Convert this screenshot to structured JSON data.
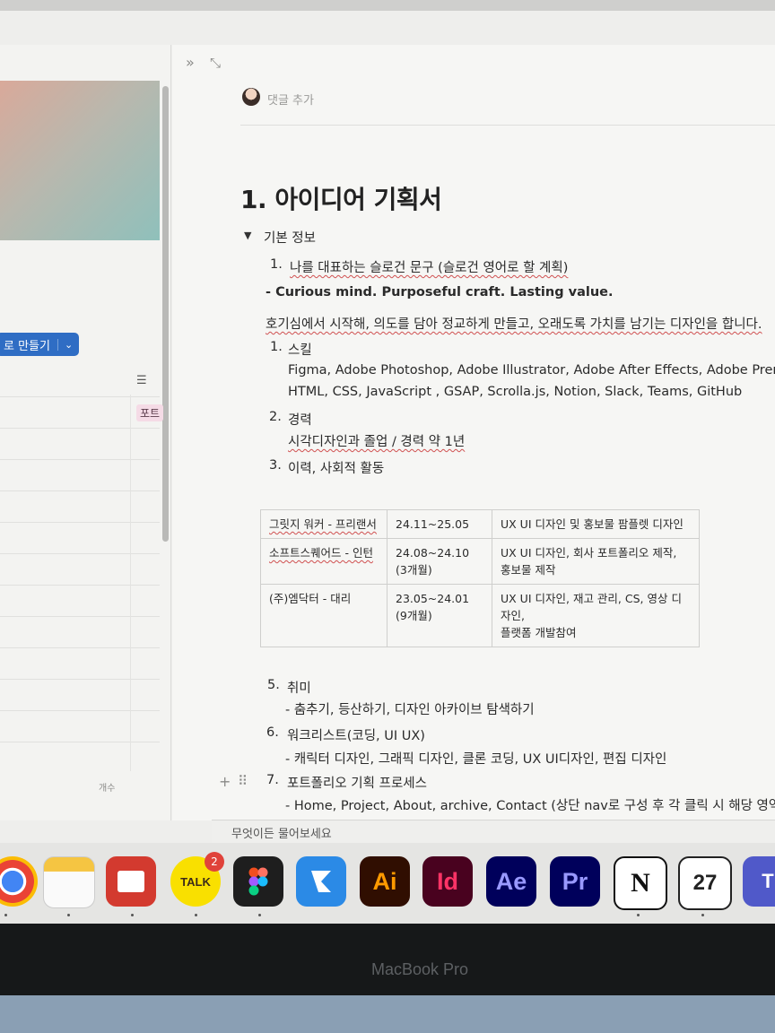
{
  "left_pane": {
    "create_button_label": "로 만들기",
    "create_button_chevron": "⌄",
    "list_icon": "☰",
    "port_tag": "포트",
    "count_label": "개수"
  },
  "document": {
    "comment_label": "댓글 추가",
    "title": "1. 아이디어 기획서",
    "toggle_label": "기본 정보",
    "slogan_heading": "나를 대표하는 슬로건 문구 (슬로건 영어로 할 계획)",
    "slogan_english": "- Curious mind. Purposeful craft. Lasting value.",
    "slogan_korean": "호기심에서 시작해, 의도를 담아 정교하게 만들고, 오래도록 가치를 남기는 디자인을 합니다.",
    "skills_heading": "스킬",
    "skills_line1": "Figma, Adobe Photoshop, Adobe Illustrator, Adobe After Effects, Adobe Prem",
    "skills_line2": "HTML, CSS, JavaScript , GSAP, Scrolla.js, Notion, Slack, Teams, GitHub",
    "career_heading": "경력",
    "career_detail": "시각디자인과 졸업 / 경력 약 1년",
    "activities_heading": "이력, 사회적 활동",
    "history_rows": [
      {
        "company": "그릿지 워커 - 프리랜서",
        "period": "24.11~25.05",
        "period_note": "",
        "work_lines": [
          "UX UI 디자인 및 홍보물 팜플렛 디자인"
        ]
      },
      {
        "company": "소프트스퀘어드 - 인턴",
        "period": "24.08~24.10",
        "period_note": "(3개월)",
        "work_lines": [
          "UX UI 디자인, 회사 포트폴리오 제작,",
          "홍보물 제작"
        ]
      },
      {
        "company": "(주)엠닥터 - 대리",
        "period": "23.05~24.01",
        "period_note": "(9개월)",
        "work_lines": [
          "UX UI 디자인, 재고 관리, CS, 영상 디",
          "자인,",
          "플랫폼 개발참여"
        ]
      }
    ],
    "hobby_heading": "취미",
    "hobby_detail": "- 춤추기, 등산하기, 디자인 아카이브 탐색하기",
    "wishlist_heading": "워크리스트(코딩, UI UX)",
    "wishlist_detail": "- 캐릭터 디자인, 그래픽 디자인, 클론 코딩, UX UI디자인, 편집 디자인",
    "process_heading": "포트폴리오 기획 프로세스",
    "process_detail": "- Home, Project, About, archive, Contact (상단 nav로 구성 후 각 클릭 시 해당 영역 스"
  },
  "numbers": {
    "n1": "1.",
    "n2": "1.",
    "n3": "2.",
    "n4": "3.",
    "n5": "5.",
    "n6": "6.",
    "n7": "7."
  },
  "search": {
    "placeholder": "무엇이든 물어보세요"
  },
  "dock": {
    "talk_label": "TALK",
    "talk_badge": "2",
    "illustrator_label": "Ai",
    "indesign_label": "Id",
    "aftereffects_label": "Ae",
    "premiere_label": "Pr",
    "notion_label": "N",
    "calendar_label": "27",
    "teams_label": "T"
  },
  "hardware": {
    "label": "MacBook Pro"
  },
  "colors": {
    "accent_blue": "#2f6dc4",
    "badge_red": "#e0423a",
    "tag_pink": "#f5dbe6"
  }
}
